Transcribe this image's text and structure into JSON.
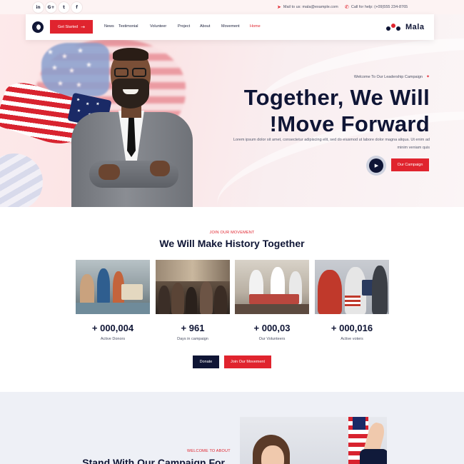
{
  "topbar": {
    "socials": [
      {
        "icon": "linkedin-icon",
        "glyph": "in"
      },
      {
        "icon": "google-plus-icon",
        "glyph": "G+"
      },
      {
        "icon": "twitter-icon",
        "glyph": "t"
      },
      {
        "icon": "facebook-icon",
        "glyph": "f"
      }
    ],
    "mail_text": "Mail to us: mala@example.com",
    "phone_text": "Call for help: (+09)555 234-8765"
  },
  "nav": {
    "get_started": "Get Started",
    "links": [
      "News",
      "Testimonial",
      "Volunteer",
      "Project",
      "About",
      "Movement",
      "Home"
    ],
    "active_link": "Home",
    "logo_text": "Mala"
  },
  "hero": {
    "welcome": "Welcome To Our Leadership Campaign",
    "title_line1": "Together, We Will",
    "title_line2": "!Move Forward",
    "description": "Lorem ipsum dolor sit amet, consectetur adipiscing elit, sed do eiusmod ut labore dolor magna aliqua. Ut enim ad minim veniam quis",
    "cta": "Our Campaign"
  },
  "movement": {
    "kicker": "JOIN OUR MOVEMENT",
    "title": "We Will Make History Together",
    "stats": [
      {
        "value": "+ 000,004",
        "label": "Active Donors"
      },
      {
        "value": "+ 961",
        "label": "Days in campaign"
      },
      {
        "value": "+ 000,03",
        "label": "Our Volunteers"
      },
      {
        "value": "+ 000,016",
        "label": "Active voters"
      }
    ],
    "donate": "Donate",
    "join": "Join Our Movement"
  },
  "about": {
    "kicker": "WELCOME TO ABOUT",
    "title": "Stand With Our Campaign For"
  },
  "colors": {
    "accent_red": "#e0242e",
    "navy": "#0f1535"
  }
}
